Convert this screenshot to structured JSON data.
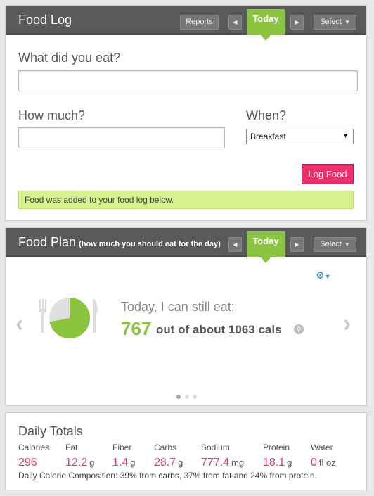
{
  "food_log": {
    "title": "Food Log",
    "reports_label": "Reports",
    "today_label": "Today",
    "select_label": "Select",
    "what_label": "What did you eat?",
    "what_value": "",
    "how_much_label": "How much?",
    "how_much_value": "",
    "when_label": "When?",
    "when_value": "Breakfast",
    "log_button": "Log Food",
    "notice": "Food was added to your food log below."
  },
  "food_plan": {
    "title": "Food Plan",
    "subtitle": "(how much you should eat for the day)",
    "today_label": "Today",
    "select_label": "Select",
    "eat_label": "Today, I can still eat:",
    "calories_left": "767",
    "calories_text": "out of about 1063 cals",
    "consumed_fraction": 0.72,
    "colors": {
      "accent": "#8bc53f",
      "pie_rest": "#e0e0e0"
    }
  },
  "daily_totals": {
    "title": "Daily Totals",
    "columns": [
      {
        "label": "Calories",
        "value": "296",
        "unit": ""
      },
      {
        "label": "Fat",
        "value": "12.2",
        "unit": "g"
      },
      {
        "label": "Fiber",
        "value": "1.4",
        "unit": "g"
      },
      {
        "label": "Carbs",
        "value": "28.7",
        "unit": "g"
      },
      {
        "label": "Sodium",
        "value": "777.4",
        "unit": "mg"
      },
      {
        "label": "Protein",
        "value": "18.1",
        "unit": "g"
      },
      {
        "label": "Water",
        "value": "0",
        "unit": "fl oz"
      }
    ],
    "composition": "Daily Calorie Composition: 39% from carbs, 37% from fat and 24% from protein."
  }
}
